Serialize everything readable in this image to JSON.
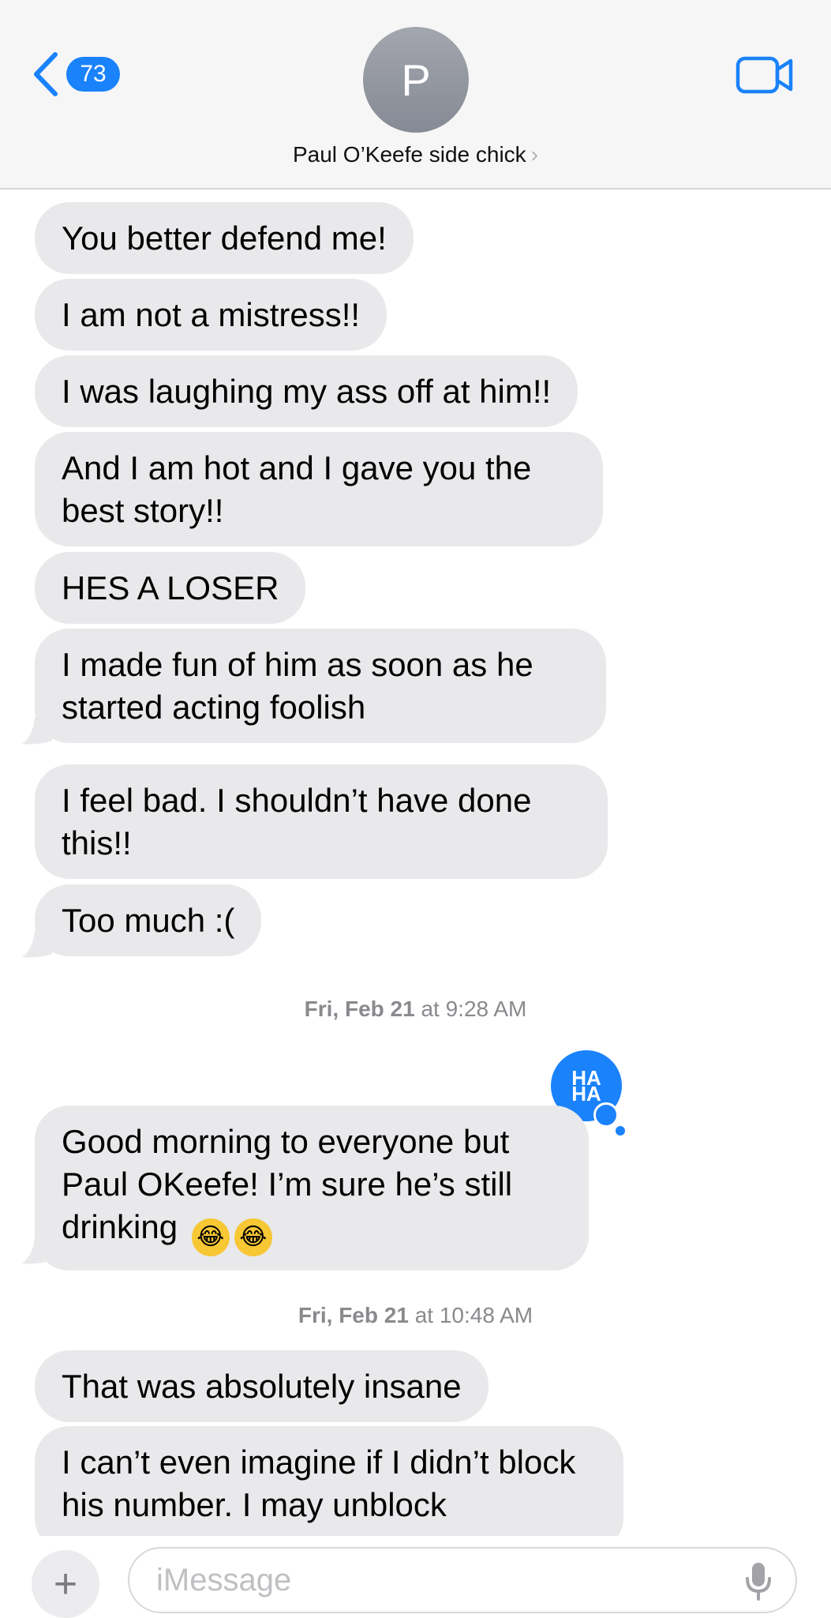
{
  "header": {
    "back_count": "73",
    "avatar_initial": "P",
    "contact_name": "Paul O’Keefe side chick",
    "name_chevron": "›",
    "video_icon": "video-camera-icon"
  },
  "messages": [
    {
      "text": "You better defend me!"
    },
    {
      "text": "I am not a mistress!!"
    },
    {
      "text": "I was laughing my ass off at him!!"
    },
    {
      "text": "And I am hot and I gave you the best story!!"
    },
    {
      "text": "HES A LOSER"
    },
    {
      "text": "I made fun of him as soon as he started acting foolish"
    },
    {
      "text": "I feel bad. I shouldn’t have done this!!"
    },
    {
      "text": "Too much :("
    },
    {
      "text": "Good morning to everyone but Paul OKeefe! I’m sure he’s still drinking",
      "emoji": "😂"
    },
    {
      "text": "That was absolutely insane"
    },
    {
      "text": "I can’t even imagine if I didn’t block his number.  I may unblock"
    }
  ],
  "timestamps": [
    {
      "day": "Fri, Feb 21",
      "time": "at 9:28 AM"
    },
    {
      "day": "Fri, Feb 21",
      "time": "at 10:48 AM"
    }
  ],
  "tapback": {
    "line1": "HA",
    "line2": "HA"
  },
  "composer": {
    "placeholder": "iMessage",
    "plus": "+"
  }
}
